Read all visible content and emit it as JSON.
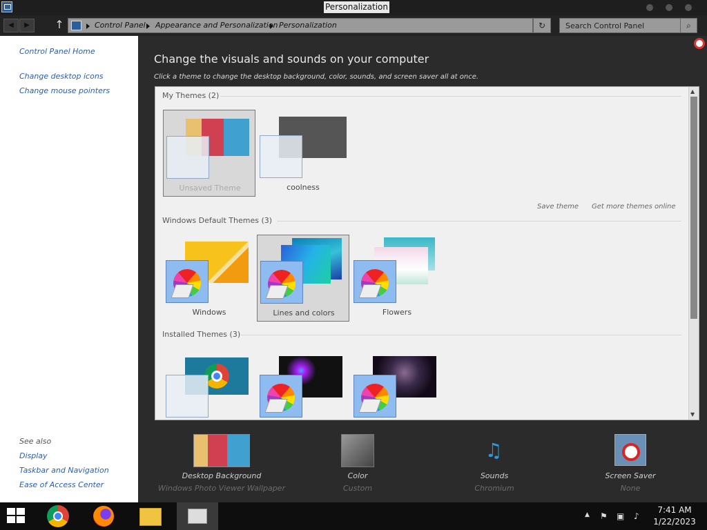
{
  "window": {
    "title": "Personalization"
  },
  "navigation": {
    "back_icon": "back-arrow-icon",
    "forward_icon": "forward-arrow-icon",
    "up_glyph": "↑",
    "breadcrumb": [
      "Control Panel",
      "Appearance and Personalization",
      "Personalization"
    ],
    "search_placeholder": "Search Control Panel",
    "refresh_glyph": "↻",
    "search_glyph": "⌕"
  },
  "sidebar": {
    "home": "Control Panel Home",
    "links": [
      "Change desktop icons",
      "Change mouse pointers"
    ],
    "see_also_heading": "See also",
    "see_also": [
      "Display",
      "Taskbar and Navigation",
      "Ease of Access Center"
    ]
  },
  "main": {
    "title": "Change the visuals and sounds on your computer",
    "subtitle": "Click a theme to change the desktop background, color, sounds, and screen saver all at once.",
    "sections": {
      "my_themes": {
        "heading": "My Themes (2)",
        "themes": [
          "Unsaved Theme",
          "coolness"
        ]
      },
      "default_themes": {
        "heading": "Windows Default Themes (3)",
        "themes": [
          "Windows",
          "Lines and colors",
          "Flowers"
        ]
      },
      "installed_themes": {
        "heading": "Installed Themes (3)"
      }
    },
    "actions": {
      "save_theme": "Save theme",
      "get_more": "Get more themes online"
    }
  },
  "bottom": {
    "desktop_background": {
      "label": "Desktop Background",
      "value": "Windows Photo Viewer Wallpaper"
    },
    "color": {
      "label": "Color",
      "value": "Custom"
    },
    "sounds": {
      "label": "Sounds",
      "value": "Chromium"
    },
    "screen_saver": {
      "label": "Screen Saver",
      "value": "None"
    }
  },
  "taskbar": {
    "time": "7:41 AM",
    "date": "1/22/2023",
    "apps": [
      "chrome-icon",
      "firefox-icon",
      "file-explorer-icon",
      "control-panel-icon"
    ]
  },
  "colors": {
    "accent": "#2a5db0",
    "window_bg": "#2b2b2b",
    "themes_bg": "#f0f0f0"
  }
}
